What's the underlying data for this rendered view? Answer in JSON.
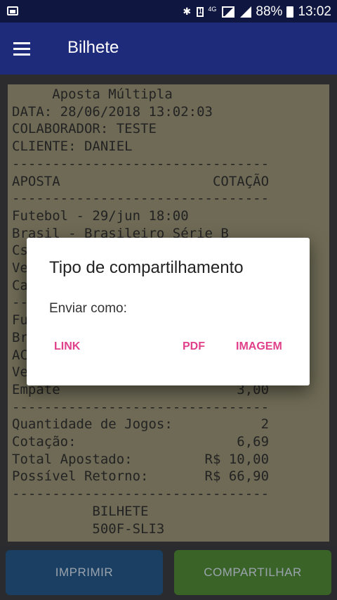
{
  "status_bar": {
    "battery_percent": "88%",
    "time": "13:02",
    "network": "4G",
    "sim_slot": "1",
    "icons": [
      "image-icon",
      "bluetooth-icon",
      "sim-icon",
      "signal-icon",
      "battery-icon"
    ]
  },
  "app_bar": {
    "title": "Bilhete",
    "menu_icon": "menu-icon"
  },
  "receipt": {
    "lines": [
      "     Aposta Múltipla",
      "DATA: 28/06/2018 13:02:03",
      "COLABORADOR: TESTE",
      "CLIENTE: DANIEL",
      "--------------------------------",
      "APOSTA                   COTAÇÃO",
      "--------------------------------",
      "Futebol - 29/jun 18:00",
      "Brasil - Brasileiro Série B",
      "Cs",
      "Ve",
      "Ca",
      "--",
      "Fu",
      "Br",
      "AC",
      "Ve",
      "Empate                      3,00",
      "--------------------------------",
      "Quantidade de Jogos:           2",
      "Cotação:                    6,69",
      "Total Apostado:         R$ 10,00",
      "Possível Retorno:       R$ 66,90",
      "--------------------------------",
      "          BILHETE",
      "          500F-SLI3"
    ]
  },
  "buttons": {
    "print": "IMPRIMIR",
    "share": "COMPARTILHAR"
  },
  "dialog": {
    "title": "Tipo de compartilhamento",
    "message": "Enviar como:",
    "actions": {
      "link": "LINK",
      "pdf": "PDF",
      "image": "IMAGEM"
    }
  },
  "colors": {
    "app_bar": "#1e2a7a",
    "status_bar": "#0f1640",
    "receipt_bg": "#6e6a55",
    "dialog_accent": "#e0408a",
    "print_button": "#1a3f63",
    "share_button": "#3a6427"
  }
}
